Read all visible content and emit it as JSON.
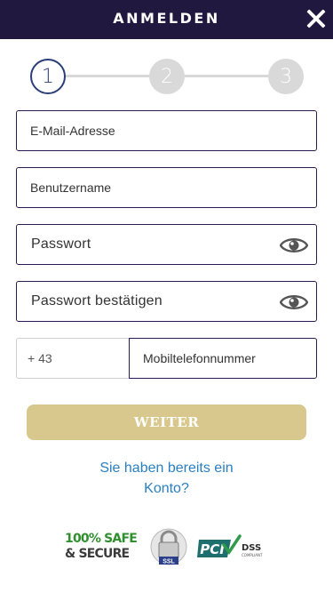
{
  "header": {
    "title": "ANMELDEN",
    "close_icon": "close-icon"
  },
  "stepper": {
    "steps": [
      "1",
      "2",
      "3"
    ],
    "active_step": 1,
    "colors": {
      "active": "#2a3e7a",
      "inactive": "#d9d9d9"
    }
  },
  "form": {
    "email_placeholder": "E-Mail-Adresse",
    "username_placeholder": "Benutzername",
    "password_placeholder": "Passwort",
    "password_confirm_placeholder": "Passwort bestätigen",
    "phone_prefix": "+ 43",
    "phone_placeholder": "Mobiltelefonnummer",
    "visibility_icon": "eye-icon"
  },
  "next_button": {
    "label": "WEITER",
    "color": "#d9c88d"
  },
  "login_link": {
    "text": "Sie haben bereits ein Konto?"
  },
  "badges": {
    "safe_line1": "100% SAFE",
    "safe_line2": "& SECURE",
    "ssl_label": "SSL",
    "pci_label": "PCI",
    "dss_label": "DSS",
    "compliant_label": "COMPLIANT"
  },
  "colors": {
    "header_bg": "#21183f",
    "field_border": "#2b1a52",
    "link": "#2a7fc1"
  }
}
